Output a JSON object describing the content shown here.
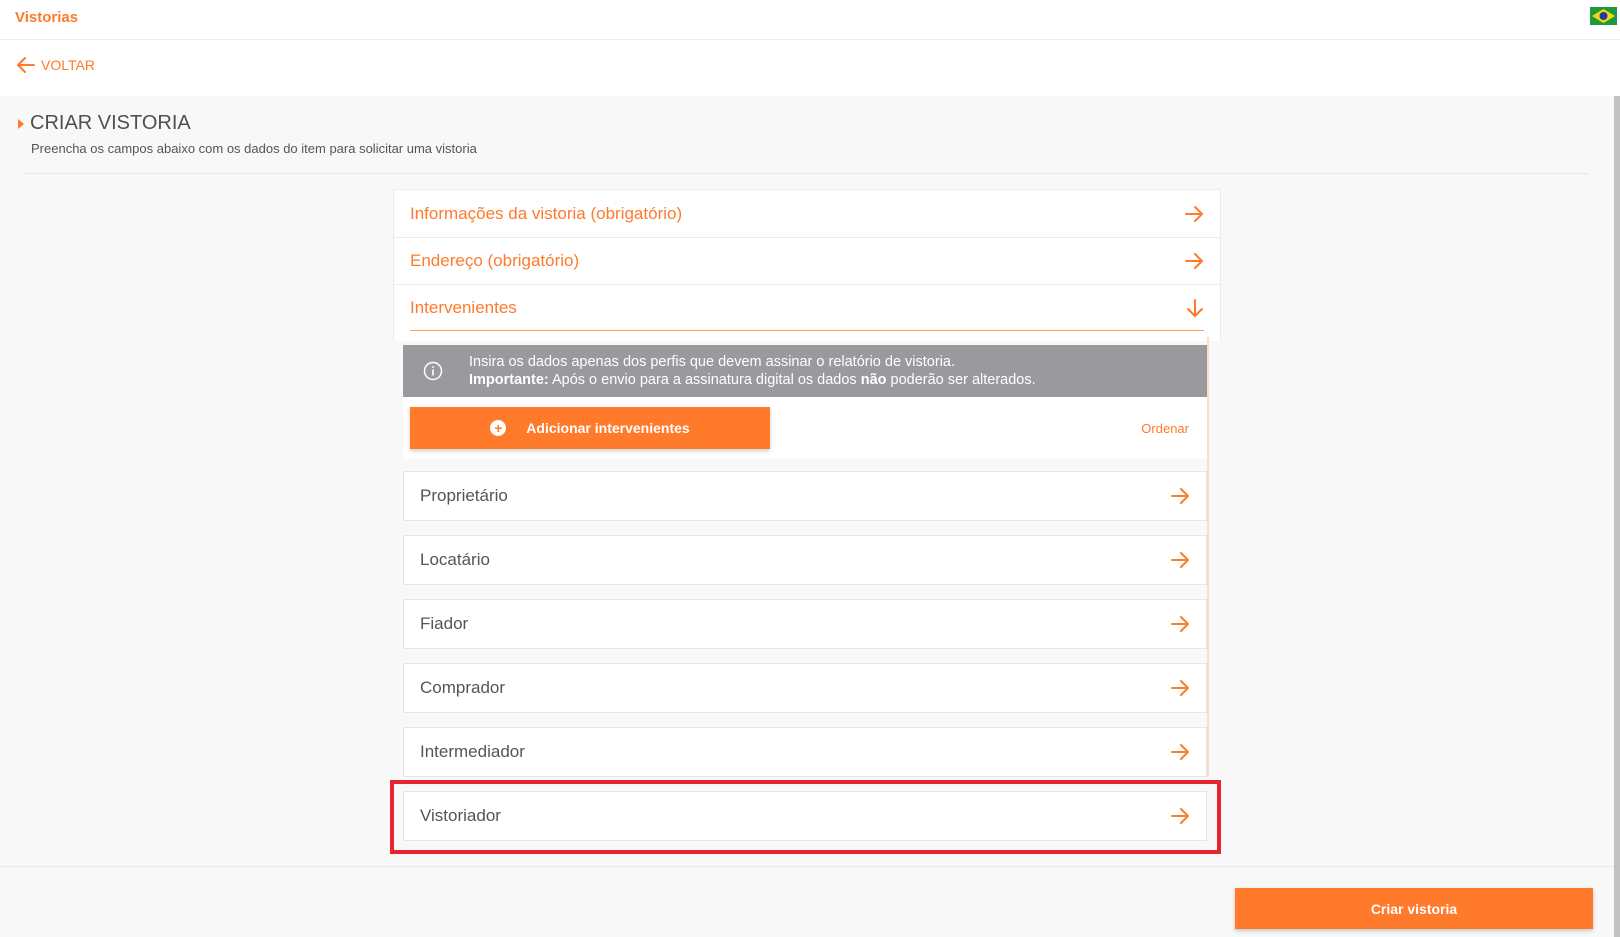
{
  "app": {
    "title": "Vistorias",
    "language_flag": "brazil-flag-icon"
  },
  "nav": {
    "back_label": "VOLTAR"
  },
  "page": {
    "title": "CRIAR VISTORIA",
    "subtitle": "Preencha os campos abaixo com os dados do item para solicitar uma vistoria"
  },
  "accordion": {
    "info_section": "Informações da vistoria (obrigatório)",
    "address_section": "Endereço (obrigatório)",
    "parties_section": "Intervenientes"
  },
  "notice": {
    "line1": "Insira os dados apenas dos perfis que devem assinar o relatório de vistoria.",
    "important_label": "Importante:",
    "line2_a": " Após o envio para a assinatura digital os dados ",
    "line2_bold": "não",
    "line2_b": " poderão ser alterados."
  },
  "actions": {
    "add_label": "Adicionar intervenientes",
    "order_label": "Ordenar"
  },
  "parties": [
    {
      "label": "Proprietário"
    },
    {
      "label": "Locatário"
    },
    {
      "label": "Fiador"
    },
    {
      "label": "Comprador"
    },
    {
      "label": "Intermediador"
    },
    {
      "label": "Vistoriador"
    }
  ],
  "footer": {
    "create_label": "Criar vistoria"
  },
  "colors": {
    "accent": "#ff7a2a",
    "highlight": "#e3262f",
    "notice_bg": "#9a9a9e"
  }
}
